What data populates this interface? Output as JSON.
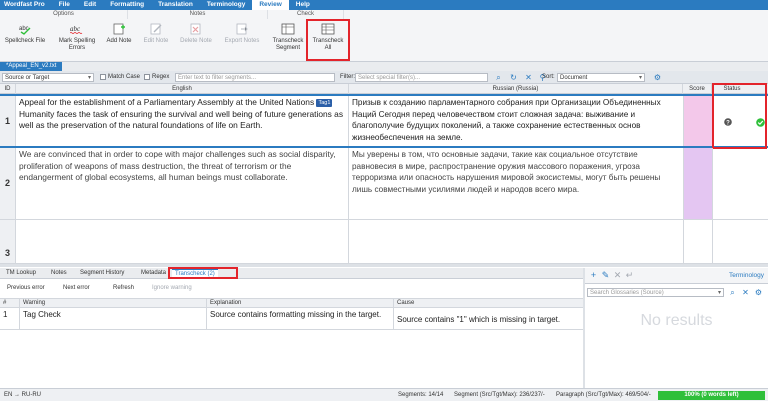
{
  "menubar": {
    "app": "Wordfast Pro",
    "items": [
      "File",
      "Edit",
      "Formatting",
      "Translation",
      "Terminology",
      "Review",
      "Help"
    ],
    "active": "Review"
  },
  "ribbon": {
    "groups": [
      "Options",
      "Notes",
      "Check"
    ],
    "buttons": [
      {
        "label": "Spellcheck File"
      },
      {
        "label": "Mark Spelling Errors"
      },
      {
        "label": "Add Note"
      },
      {
        "label": "Edit Note"
      },
      {
        "label": "Delete Note"
      },
      {
        "label": "Export Notes"
      },
      {
        "label": "Transcheck Segment"
      },
      {
        "label": "Transcheck All"
      }
    ]
  },
  "doc_tab": "*Appeal_EN_v2.txt",
  "filter": {
    "scope": "Source or Target",
    "match_case": "Match Case",
    "regex": "Regex",
    "segment_placeholder": "Enter text to filter segments...",
    "filter_label": "Filter:",
    "special_placeholder": "Select special filter(s)...",
    "sort_label": "Sort:",
    "sort_value": "Document"
  },
  "grid": {
    "headers": {
      "id": "ID",
      "source": "English",
      "target": "Russian (Russia)",
      "score": "Score",
      "status": "Status"
    },
    "rows": [
      {
        "id": "1",
        "source_pre": "Appeal for the establishment of a Parliamentary Assembly at the United Nations",
        "tag": "Tag1",
        "source_post": "Humanity faces the task of ensuring the survival and well being of future generations as well as the preservation of the natural foundations of life on Earth.",
        "target": "Призыв к созданию парламентарного собрания при Организации Объединенных Наций Сегодня перед человечеством стоит сложная задача: выживание и благополучие будущих поколений, а также сохранение естественных основ жизнеобеспечения на земле."
      },
      {
        "id": "2",
        "source_pre": "We are convinced that in order to cope with major challenges such as social disparity, proliferation of weapons of mass destruction, the threat of terrorism or the endangerment of global ecosystems, all human beings must collaborate.",
        "tag": "",
        "source_post": "",
        "target": "Мы уверены в том, что основные задачи, такие как социальное отсутствие равновесия в мире, распространение оружия массового поражения, угроза терроризма или опасность нарушения мировой экосистемы, могут быть решены лишь совместными усилиями людей и народов всего мира."
      },
      {
        "id": "3",
        "source_pre": "",
        "tag": "",
        "source_post": "",
        "target": ""
      }
    ],
    "colors": {
      "score_fill": "#f3c8ea",
      "active_border": "#2b7bc0",
      "highlight": "#e3242b"
    }
  },
  "bottom": {
    "tabs": [
      "TM Lookup",
      "Notes",
      "Segment History",
      "Metadata",
      "Transcheck (2)"
    ],
    "active_tab": "Transcheck (2)",
    "toolbar": [
      "Previous error",
      "Next error",
      "Refresh",
      "Ignore warning"
    ],
    "headers": [
      "#",
      "Warning",
      "Explanation",
      "Cause"
    ],
    "rows": [
      {
        "num": "1",
        "warning": "Tag Check",
        "explanation": "Source contains formatting missing in the target.",
        "cause": "Source contains \"1\" which is missing in target."
      }
    ]
  },
  "terminology": {
    "title": "Terminology",
    "search_placeholder": "Search Glossaries (Source)",
    "empty_text": "No results"
  },
  "statusbar": {
    "lang": "EN → RU-RU",
    "segments": "Segments: 14/14",
    "segment_counts": "Segment (Src/Tgt/Max): 236/237/-",
    "paragraph": "Paragraph (Src/Tgt/Max): 469/504/-",
    "progress_text": "100% (0 words left)",
    "progress_value": 1.0,
    "progress_color": "#2fbf3a"
  }
}
